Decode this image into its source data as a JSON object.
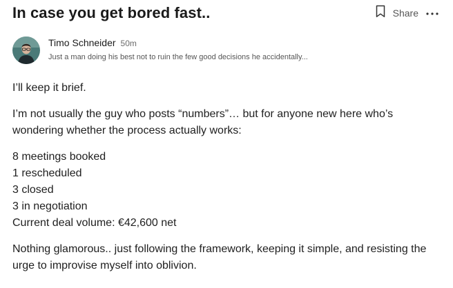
{
  "post": {
    "title": "In case you get bored fast..",
    "share_label": "Share"
  },
  "author": {
    "name": "Timo Schneider",
    "time": "50m",
    "bio": "Just a man doing his best not to ruin the few good decisions he accidentally..."
  },
  "body": {
    "intro": "I’ll keep it brief.",
    "context": "I’m not usually the guy who posts “numbers”… but for anyone new here who’s wondering whether the process actually works:",
    "stats": [
      "8 meetings booked",
      "1 rescheduled",
      "3 closed",
      "3 in negotiation",
      "Current deal volume: €42,600 net"
    ],
    "closing": "Nothing glamorous.. just following the framework, keeping it simple, and resisting the urge to improvise myself into oblivion."
  },
  "icons": {
    "bookmark": "bookmark-icon",
    "more": "more-horizontal-icon",
    "avatar": "avatar"
  },
  "colors": {
    "text": "#1f1f1f",
    "muted": "#555555",
    "avatar_bg": "#4a7a78"
  }
}
